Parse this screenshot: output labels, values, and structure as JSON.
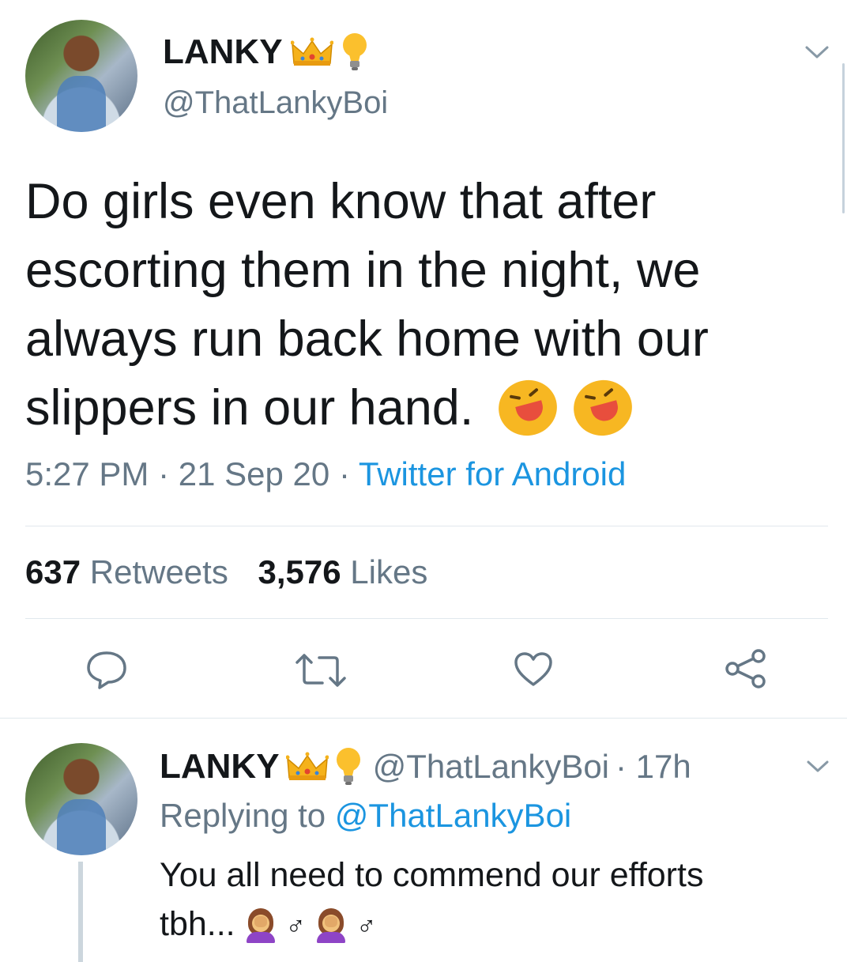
{
  "tweet": {
    "display_name": "LANKY",
    "handle": "@ThatLankyBoi",
    "text_lines": [
      "Do girls even know that after",
      "escorting them in the night, we",
      "always run back home with our",
      "slippers in our hand."
    ],
    "time": "5:27 PM",
    "date": "21 Sep 20",
    "sep": "·",
    "source": "Twitter for Android",
    "retweets_count": "637",
    "retweets_label": "Retweets",
    "likes_count": "3,576",
    "likes_label": "Likes",
    "emojis": [
      "rolling-on-floor-laughing",
      "rolling-on-floor-laughing",
      "crown",
      "light-bulb"
    ]
  },
  "reply": {
    "display_name": "LANKY",
    "handle": "@ThatLankyBoi",
    "age": "· 17h",
    "replying_prefix": "Replying to",
    "replying_handle": "@ThatLankyBoi",
    "text_line1": "You all need to commend our efforts",
    "text_line2": "tbh...",
    "male_sign": "♂"
  },
  "colors": {
    "text": "#14171a",
    "secondary": "#657786",
    "accent": "#1b95e0",
    "divider": "#e1e8ed"
  }
}
